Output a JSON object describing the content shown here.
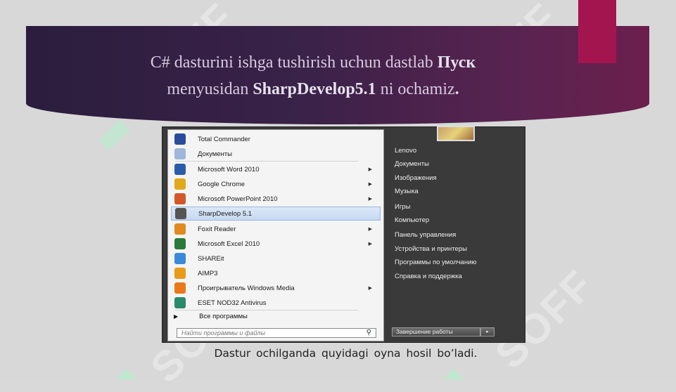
{
  "slide": {
    "title_part1": "C#  dasturini  ishga tushirish  uchun  dastlab ",
    "title_bold1": "Пуск",
    "title_part2": "menyusidan  ",
    "title_bold2": "SharpDevelop5.1",
    "title_part3": "  ni ochamiz",
    "title_period": ".",
    "caption": "Dastur  ochilganda  quyidagi  oyna  hosil  bo’ladi.",
    "watermark": "SOFF",
    "colors": {
      "accent": "#a3154f",
      "banner": "#3a2248",
      "watermark_green": "#b8e8c8"
    }
  },
  "start_menu": {
    "programs": [
      {
        "label": "Total Commander",
        "icon": "total-commander-icon",
        "color": "#2a4c9a",
        "arrow": false
      },
      {
        "label": "Документы",
        "icon": "documents-icon",
        "color": "#9fb6d8",
        "arrow": false
      },
      {
        "label": "Microsoft Word 2010",
        "icon": "word-icon",
        "color": "#2a5caa",
        "arrow": true
      },
      {
        "label": "Google Chrome",
        "icon": "chrome-icon",
        "color": "#e2a81c",
        "arrow": true
      },
      {
        "label": "Microsoft PowerPoint 2010",
        "icon": "powerpoint-icon",
        "color": "#d2582a",
        "arrow": true
      },
      {
        "label": "SharpDevelop 5.1",
        "icon": "sharpdevelop-icon",
        "color": "#555555",
        "arrow": false,
        "selected": true
      },
      {
        "label": "Foxit Reader",
        "icon": "foxit-icon",
        "color": "#e08a20",
        "arrow": true
      },
      {
        "label": "Microsoft Excel 2010",
        "icon": "excel-icon",
        "color": "#2a7a3a",
        "arrow": true
      },
      {
        "label": "SHAREit",
        "icon": "shareit-icon",
        "color": "#3a8ad8",
        "arrow": false
      },
      {
        "label": "AIMP3",
        "icon": "aimp-icon",
        "color": "#e89a1a",
        "arrow": false
      },
      {
        "label": "Проигрыватель Windows Media",
        "icon": "windows-media-icon",
        "color": "#e8781a",
        "arrow": true
      },
      {
        "label": "ESET NOD32 Antivirus",
        "icon": "eset-icon",
        "color": "#2a8a6a",
        "arrow": false
      }
    ],
    "all_programs": "Все программы",
    "search_placeholder": "Найти программы и файлы",
    "right_items": [
      "Lenovo",
      "Документы",
      "Изображения",
      "Музыка",
      "Игры",
      "Компьютер",
      "Панель управления",
      "Устройства и принтеры",
      "Программы по умолчанию",
      "Справка и поддержка"
    ],
    "shutdown_label": "Завершение работы",
    "shutdown_arrow": "▸"
  }
}
